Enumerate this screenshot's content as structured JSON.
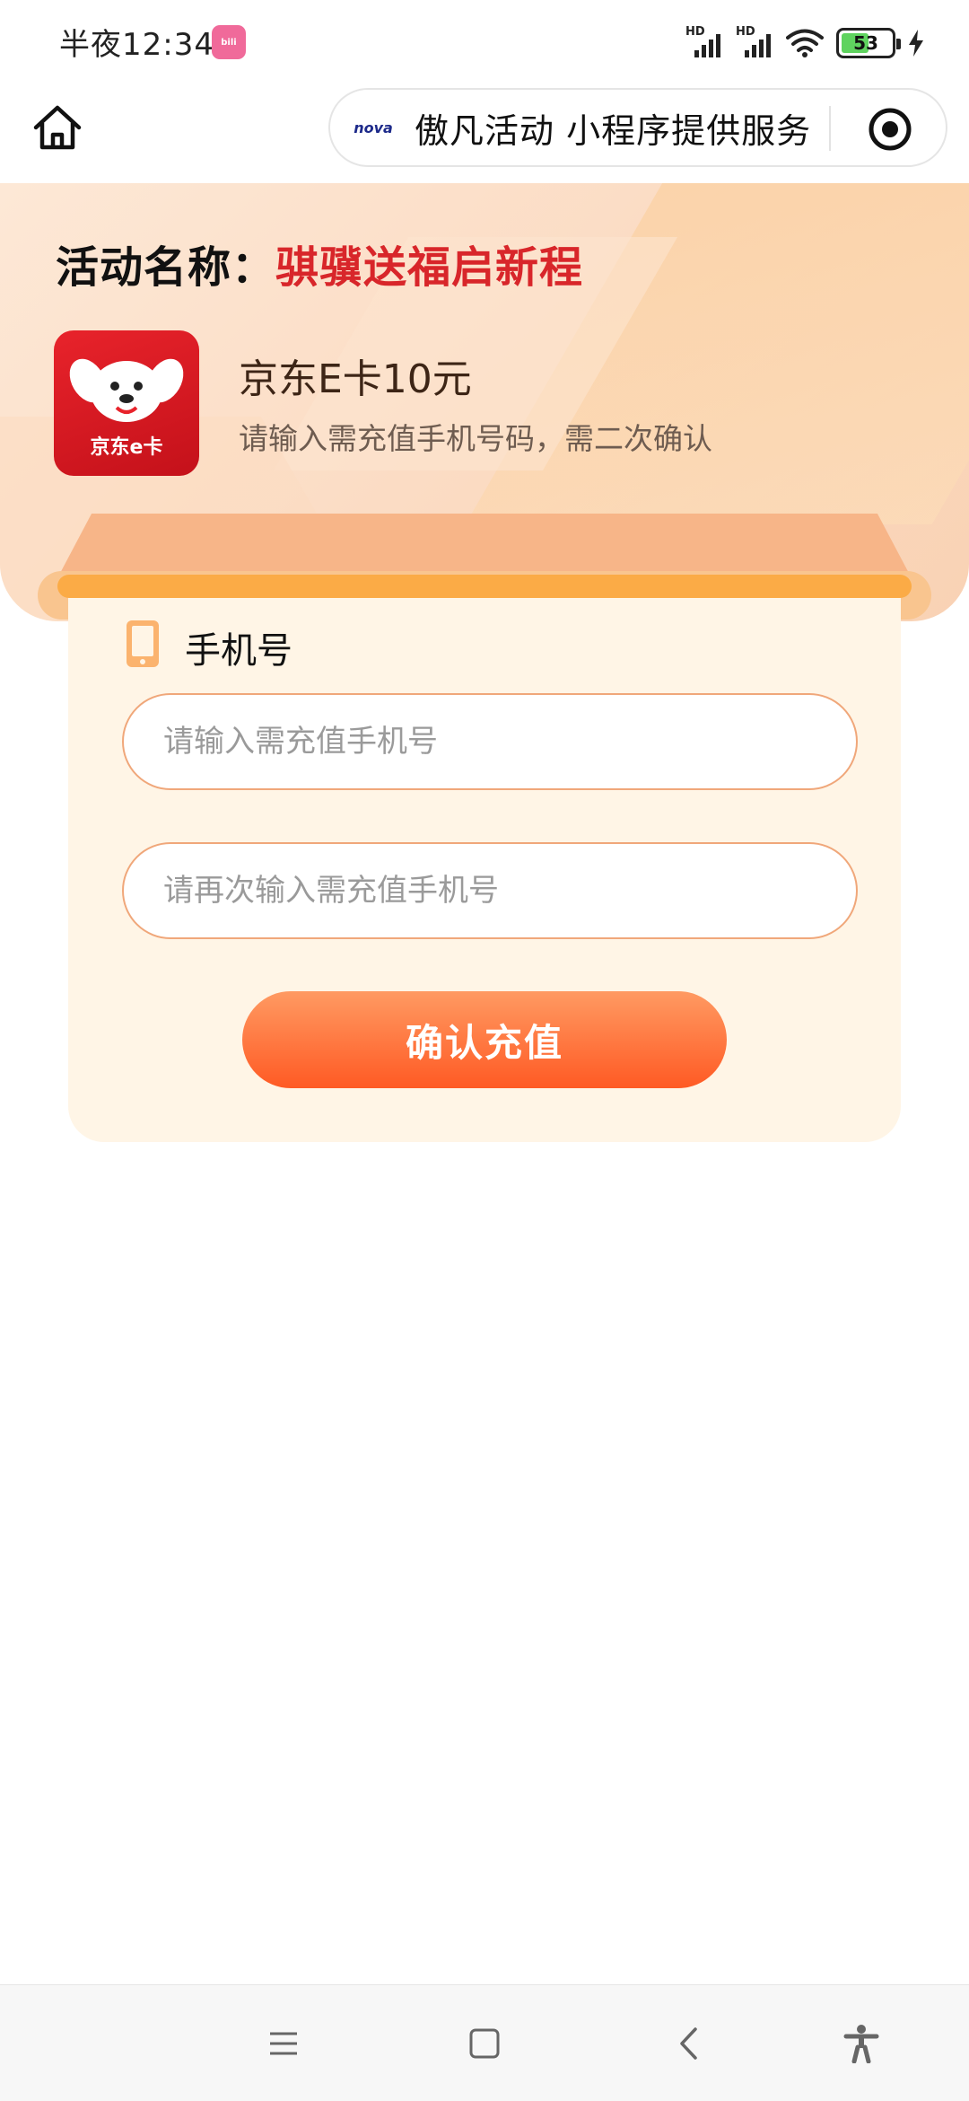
{
  "status_bar": {
    "time": "半夜12:34",
    "battery_level": "53",
    "signal_label_1": "HD",
    "signal_label_2": "HD"
  },
  "nav": {
    "capsule_logo_text": "nova",
    "capsule_title": "傲凡活动 小程序提供服务"
  },
  "activity": {
    "label": "活动名称：",
    "name": "骐骥送福启新程"
  },
  "product": {
    "logo_text": "京东e卡",
    "name": "京东E卡10元",
    "description": "请输入需充值手机号码，需二次确认"
  },
  "form": {
    "phone_label": "手机号",
    "phone_placeholder": "请输入需充值手机号",
    "phone_confirm_placeholder": "请再次输入需充值手机号",
    "submit_label": "确认充值"
  },
  "colors": {
    "accent": "#ff5a24",
    "activity_name": "#d8262a",
    "card_background": "#fff5e6",
    "input_border": "#f0a77a"
  },
  "icons": {
    "home": "home-icon",
    "capsule_target": "target-icon",
    "phone": "phone-icon",
    "system_menu": "menu-icon",
    "system_home": "square-icon",
    "system_back": "back-icon",
    "system_accessibility": "accessibility-icon"
  }
}
